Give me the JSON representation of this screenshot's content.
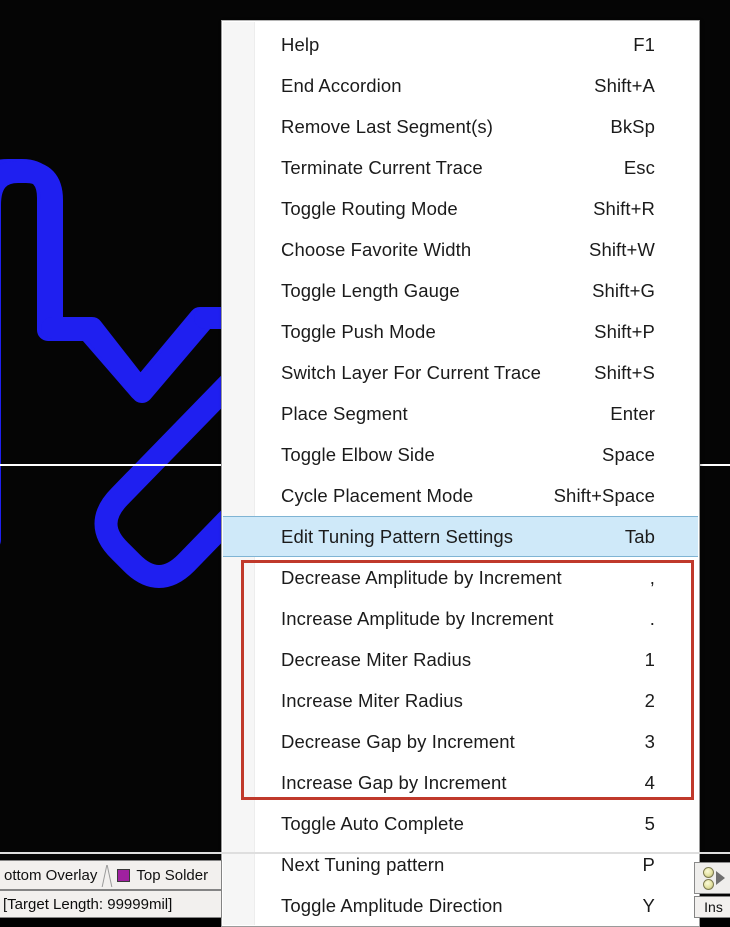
{
  "app": {
    "canvas_background": "#050505",
    "trace_color": "#1f1ff0",
    "guide_line_color": "#ffffff"
  },
  "context_menu": {
    "background": "#ffffff",
    "border_color": "#9a9a9a",
    "gutter_color": "#f6f6f6",
    "selected_background": "#cfe9f9",
    "selected_border": "#7fb4d4",
    "items": [
      {
        "label": "Help",
        "shortcut": "F1"
      },
      {
        "label": "End Accordion",
        "shortcut": "Shift+A"
      },
      {
        "label": "Remove Last Segment(s)",
        "shortcut": "BkSp"
      },
      {
        "label": "Terminate Current Trace",
        "shortcut": "Esc"
      },
      {
        "label": "Toggle Routing Mode",
        "shortcut": "Shift+R"
      },
      {
        "label": "Choose Favorite Width",
        "shortcut": "Shift+W"
      },
      {
        "label": "Toggle Length Gauge",
        "shortcut": "Shift+G"
      },
      {
        "label": "Toggle Push Mode",
        "shortcut": "Shift+P"
      },
      {
        "label": "Switch Layer For Current Trace",
        "shortcut": "Shift+S"
      },
      {
        "label": "Place Segment",
        "shortcut": "Enter"
      },
      {
        "label": "Toggle Elbow Side",
        "shortcut": "Space"
      },
      {
        "label": "Cycle Placement Mode",
        "shortcut": "Shift+Space"
      },
      {
        "label": "Edit Tuning Pattern Settings",
        "shortcut": "Tab",
        "selected": true
      },
      {
        "label": "Decrease Amplitude by Increment",
        "shortcut": ","
      },
      {
        "label": "Increase Amplitude by Increment",
        "shortcut": "."
      },
      {
        "label": "Decrease Miter Radius",
        "shortcut": "1"
      },
      {
        "label": "Increase Miter Radius",
        "shortcut": "2"
      },
      {
        "label": "Decrease Gap by Increment",
        "shortcut": "3"
      },
      {
        "label": "Increase Gap by Increment",
        "shortcut": "4"
      },
      {
        "label": "Toggle Auto Complete",
        "shortcut": "5"
      },
      {
        "label": "Next Tuning pattern",
        "shortcut": "P"
      },
      {
        "label": "Toggle Amplitude Direction",
        "shortcut": "Y"
      }
    ]
  },
  "annotation": {
    "color": "#c0392b",
    "covers_items": [
      "Decrease Amplitude by Increment",
      "Increase Amplitude by Increment",
      "Decrease Miter Radius",
      "Increase Miter Radius",
      "Decrease Gap by Increment",
      "Increase Gap by Increment"
    ]
  },
  "layer_tabs": {
    "tabs": [
      {
        "label": "ottom Overlay",
        "swatch": null
      },
      {
        "label": "Top Solder",
        "swatch": "#a021a0"
      }
    ]
  },
  "status_bar": {
    "text": "[Target Length:  99999mil]"
  },
  "right_widget": {
    "icon": "two-dots-play-icon",
    "status_label": "Ins"
  }
}
